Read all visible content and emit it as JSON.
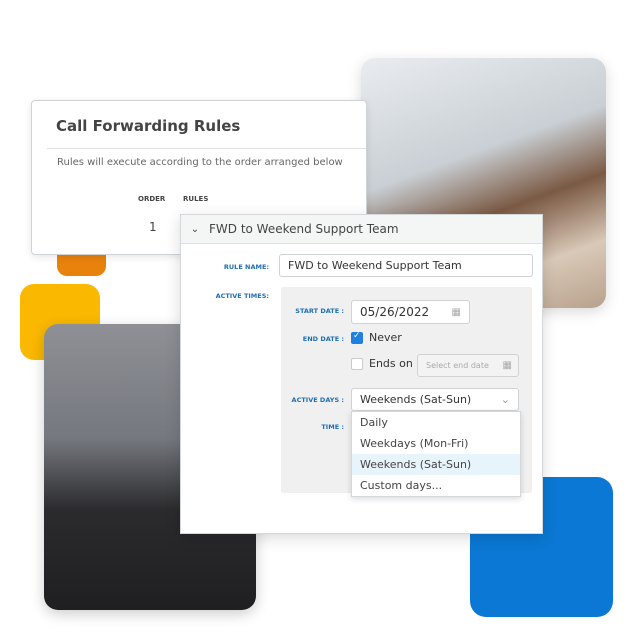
{
  "colors": {
    "orange": "#e8820c",
    "yellow": "#fbb800",
    "blue": "#0a78d4",
    "label_blue": "#1f6fb5"
  },
  "card": {
    "title": "Call Forwarding Rules",
    "subtitle": "Rules will execute according to the order arranged below",
    "columns": [
      "ORDER",
      "RULES"
    ],
    "order": "1"
  },
  "rule": {
    "header": "FWD to Weekend Support Team",
    "rule_name_label": "RULE NAME:",
    "rule_name": "FWD to Weekend Support Team",
    "active_times_label": "ACTIVE TIMES:",
    "start_date_label": "START DATE :",
    "start_date": "05/26/2022",
    "end_date_label": "END DATE :",
    "never_label": "Never",
    "never_checked": true,
    "ends_on_label": "Ends on",
    "ends_on_checked": false,
    "end_date_placeholder": "Select end date",
    "active_days_label": "ACTIVE DAYS :",
    "active_days": "Weekends (Sat-Sun)",
    "time_label": "TIME :",
    "options": [
      "Daily",
      "Weekdays (Mon-Fri)",
      "Weekends (Sat-Sun)",
      "Custom days..."
    ],
    "selected_option": 2
  }
}
